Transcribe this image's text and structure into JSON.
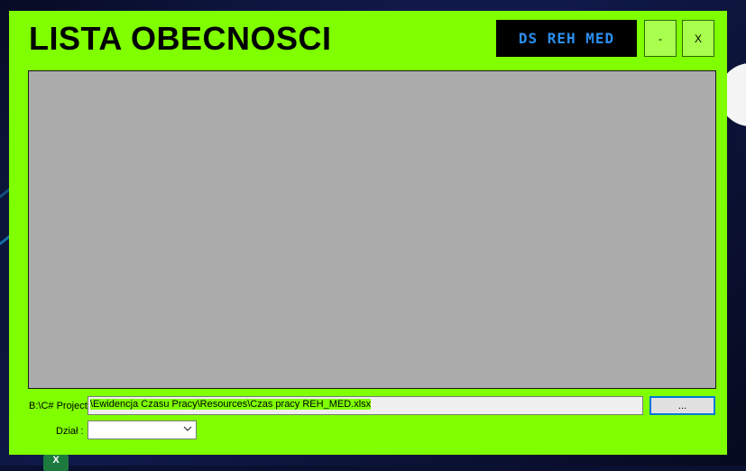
{
  "window": {
    "title": "LISTA OBECNOSCI",
    "logo_text": "DS REH MED",
    "minimize_label": "-",
    "close_label": "X"
  },
  "file": {
    "path_prefix": "B:\\C# Project",
    "path_selected": "\\Ewidencja Czasu Pracy\\Resources\\Czas pracy REH_MED.xlsx",
    "browse_label": "..."
  },
  "department": {
    "label": "Dział :",
    "selected_value": ""
  },
  "taskbar": {
    "excel_icon_text": "X"
  },
  "colors": {
    "window_bg": "#7fff00",
    "grid_bg": "#ababab",
    "logo_text": "#2b8ff0",
    "focus_border": "#0078d7"
  }
}
